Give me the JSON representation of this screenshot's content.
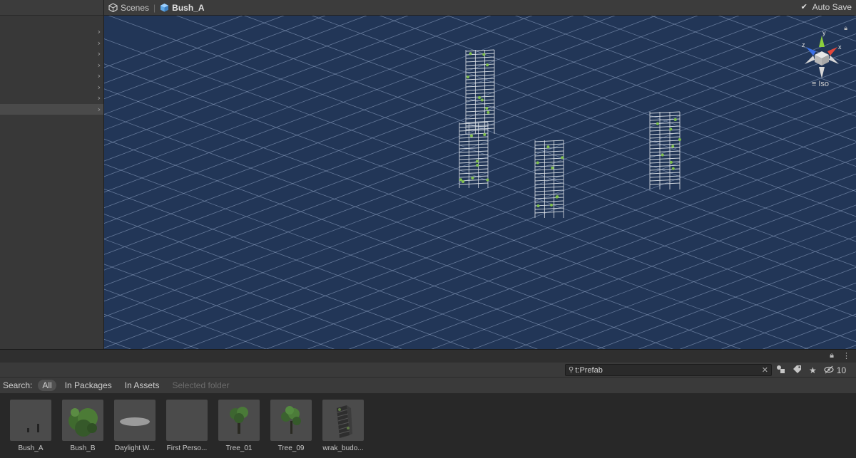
{
  "scene_header": {
    "scenes_label": "Scenes",
    "current_object": "Bush_A",
    "auto_save_label": "Auto Save",
    "auto_save_checked": true
  },
  "hierarchy": {
    "row_count": 8,
    "selected_index": 7
  },
  "viewport": {
    "background_color": "#223657",
    "grid_color": "#8fa3c4",
    "gizmo_axes": [
      "x",
      "y",
      "z"
    ],
    "projection_label": "Iso"
  },
  "project": {
    "search_value": "t:Prefab",
    "hidden_count": "10",
    "search_label": "Search:",
    "filters": [
      {
        "label": "All",
        "state": "active"
      },
      {
        "label": "In Packages",
        "state": "normal"
      },
      {
        "label": "In Assets",
        "state": "normal"
      },
      {
        "label": "Selected folder",
        "state": "disabled"
      }
    ],
    "assets": [
      {
        "label": "Bush_A",
        "icon": "tiny-prefab"
      },
      {
        "label": "Bush_B",
        "icon": "bush"
      },
      {
        "label": "Daylight W...",
        "icon": "flat-disc"
      },
      {
        "label": "First Perso...",
        "icon": "empty"
      },
      {
        "label": "Tree_01",
        "icon": "tree"
      },
      {
        "label": "Tree_09",
        "icon": "tree"
      },
      {
        "label": "wrak_budo...",
        "icon": "building"
      }
    ]
  }
}
